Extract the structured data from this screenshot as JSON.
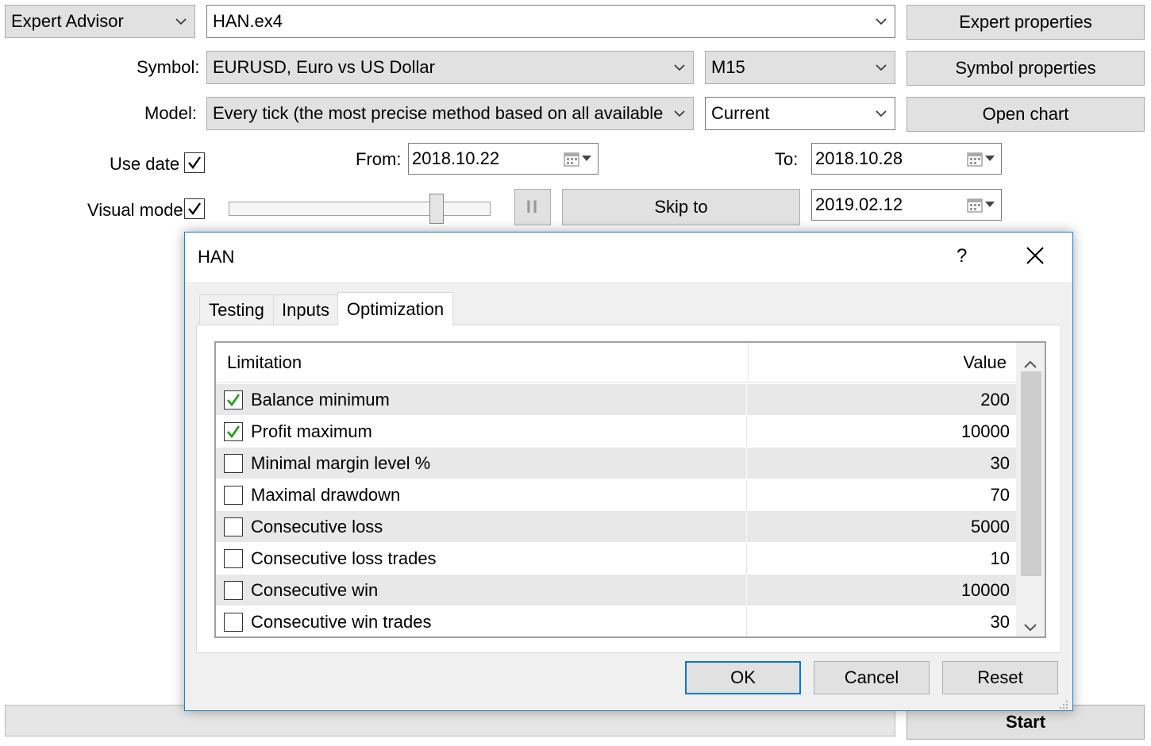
{
  "main": {
    "type_select": "Expert Advisor",
    "expert_file": "HAN.ex4",
    "expert_properties": "Expert properties",
    "symbol_label": "Symbol:",
    "symbol_value": "EURUSD, Euro vs US Dollar",
    "period_value": "M15",
    "symbol_properties": "Symbol properties",
    "model_label": "Model:",
    "model_value": "Every tick (the most precise method based on all available le",
    "spread_value": "Current",
    "open_chart": "Open chart",
    "use_date_label": "Use date",
    "use_date_checked": true,
    "from_label": "From:",
    "from_date": "2018.10.22",
    "to_label": "To:",
    "to_date": "2018.10.28",
    "visual_mode_label": "Visual mode",
    "visual_mode_checked": true,
    "pause_symbol": "II",
    "skip_to": "Skip to",
    "skip_date": "2019.02.12",
    "start": "Start"
  },
  "dialog": {
    "title": "HAN",
    "help": "?",
    "tabs": [
      "Testing",
      "Inputs",
      "Optimization"
    ],
    "active_tab": "Optimization",
    "columns": {
      "limitation": "Limitation",
      "value": "Value"
    },
    "rows": [
      {
        "name": "Balance minimum",
        "value": "200",
        "checked": true
      },
      {
        "name": "Profit maximum",
        "value": "10000",
        "checked": true
      },
      {
        "name": "Minimal margin level %",
        "value": "30",
        "checked": false
      },
      {
        "name": "Maximal drawdown",
        "value": "70",
        "checked": false
      },
      {
        "name": "Consecutive loss",
        "value": "5000",
        "checked": false
      },
      {
        "name": "Consecutive loss trades",
        "value": "10",
        "checked": false
      },
      {
        "name": "Consecutive win",
        "value": "10000",
        "checked": false
      },
      {
        "name": "Consecutive win trades",
        "value": "30",
        "checked": false
      }
    ],
    "ok": "OK",
    "cancel": "Cancel",
    "reset": "Reset"
  },
  "colors": {
    "accent": "#0078d7",
    "check_green": "#1a9e1a",
    "button_face": "#e1e1e1"
  }
}
